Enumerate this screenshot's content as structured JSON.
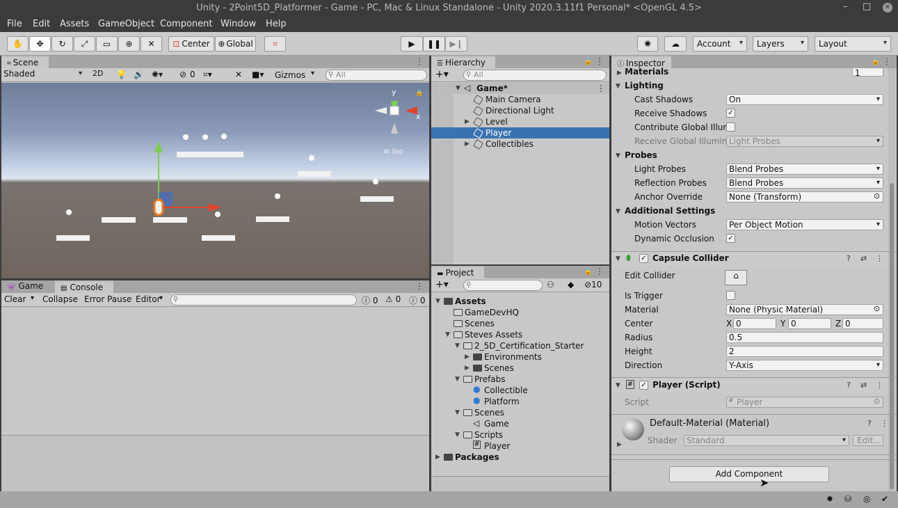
{
  "window": {
    "title": "Unity - 2Point5D_Platformer - Game - PC, Mac & Linux Standalone - Unity 2020.3.11f1 Personal* <OpenGL 4.5>"
  },
  "menu": [
    "File",
    "Edit",
    "Assets",
    "GameObject",
    "Component",
    "Window",
    "Help"
  ],
  "toolbar": {
    "pivot": "Center",
    "space": "Global",
    "account": "Account",
    "layers": "Layers",
    "layout": "Layout"
  },
  "scene": {
    "tab": "Scene",
    "shading": "Shaded",
    "mode2d": "2D",
    "hidden_count": "0",
    "gizmos": "Gizmos",
    "search_placeholder": "All",
    "axis_y": "y",
    "axis_x": "x",
    "projection": "Iso"
  },
  "console": {
    "tabs": [
      "Game",
      "Console"
    ],
    "clear": "Clear",
    "collapse": "Collapse",
    "error_pause": "Error Pause",
    "editor": "Editor",
    "counts": [
      "0",
      "0",
      "0"
    ]
  },
  "hierarchy": {
    "tab": "Hierarchy",
    "search_placeholder": "All",
    "root": "Game*",
    "items": [
      "Main Camera",
      "Directional Light",
      "Level",
      "Player",
      "Collectibles"
    ],
    "selected": "Player"
  },
  "project": {
    "tab": "Project",
    "hidden_count": "10",
    "tree": [
      {
        "label": "Assets",
        "bold": true
      },
      {
        "label": "GameDevHQ"
      },
      {
        "label": "Scenes"
      },
      {
        "label": "Steves Assets"
      },
      {
        "label": "2_5D_Certification_Starter"
      },
      {
        "label": "Environments"
      },
      {
        "label": "Scenes"
      },
      {
        "label": "Prefabs"
      },
      {
        "label": "Collectible"
      },
      {
        "label": "Platform"
      },
      {
        "label": "Scenes"
      },
      {
        "label": "Game"
      },
      {
        "label": "Scripts"
      },
      {
        "label": "Player"
      },
      {
        "label": "Packages",
        "bold": true
      }
    ]
  },
  "inspector": {
    "tab": "Inspector",
    "materials_label": "Materials",
    "materials_value": "1",
    "lighting": {
      "header": "Lighting",
      "cast_shadows": {
        "label": "Cast Shadows",
        "value": "On"
      },
      "receive_shadows": {
        "label": "Receive Shadows",
        "checked": "✓"
      },
      "contribute_gi": {
        "label": "Contribute Global Illumi"
      },
      "receive_gi": {
        "label": "Receive Global Illumina",
        "value": "Light Probes"
      }
    },
    "probes": {
      "header": "Probes",
      "light_probes": {
        "label": "Light Probes",
        "value": "Blend Probes"
      },
      "reflection_probes": {
        "label": "Reflection Probes",
        "value": "Blend Probes"
      },
      "anchor_override": {
        "label": "Anchor Override",
        "value": "None (Transform)"
      }
    },
    "additional": {
      "header": "Additional Settings",
      "motion_vectors": {
        "label": "Motion Vectors",
        "value": "Per Object Motion"
      },
      "dynamic_occlusion": {
        "label": "Dynamic Occlusion",
        "checked": "✓"
      }
    },
    "capsule": {
      "header": "Capsule Collider",
      "edit_collider": "Edit Collider",
      "is_trigger": "Is Trigger",
      "material": {
        "label": "Material",
        "value": "None (Physic Material)"
      },
      "center": {
        "label": "Center",
        "x": "0",
        "y": "0",
        "z": "0"
      },
      "radius": {
        "label": "Radius",
        "value": "0.5"
      },
      "height": {
        "label": "Height",
        "value": "2"
      },
      "direction": {
        "label": "Direction",
        "value": "Y-Axis"
      }
    },
    "player_script": {
      "header": "Player (Script)",
      "script_label": "Script",
      "script_value": "Player"
    },
    "material": {
      "name": "Default-Material (Material)",
      "shader_label": "Shader",
      "shader_value": "Standard",
      "edit": "Edit..."
    },
    "add_component": "Add Component"
  },
  "axes_letters": {
    "x": "X",
    "y": "Y",
    "z": "Z"
  }
}
